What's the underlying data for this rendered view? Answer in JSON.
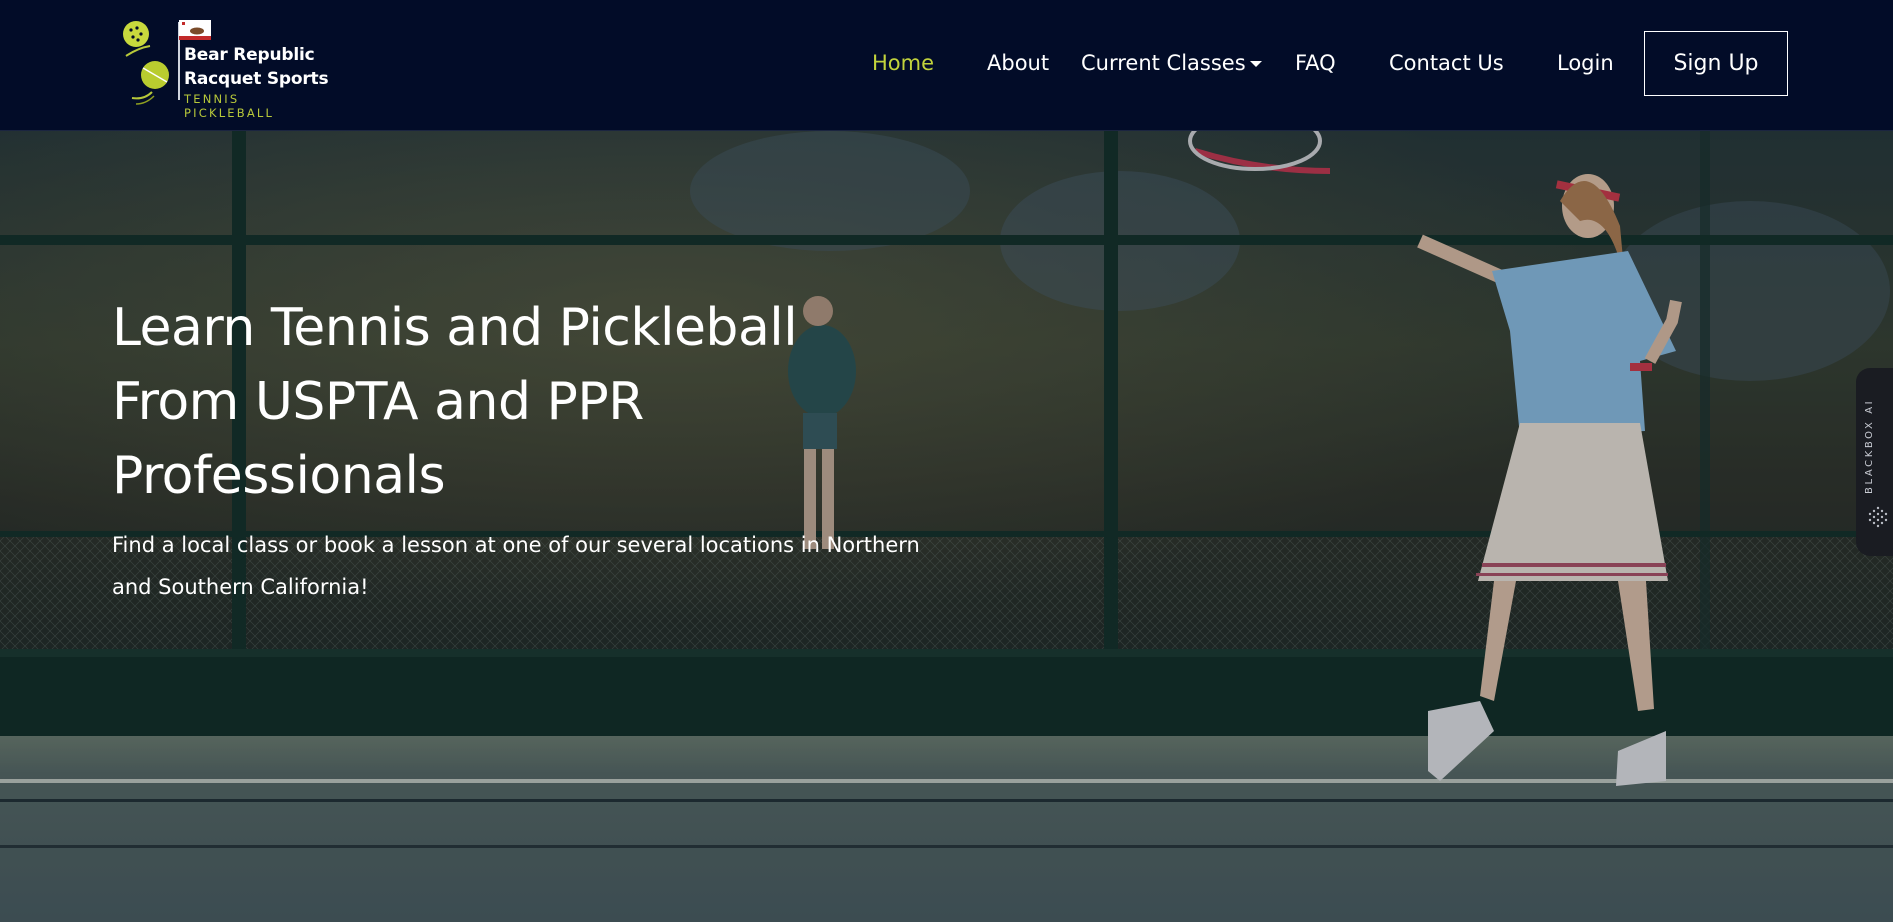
{
  "brand": {
    "line1": "Bear Republic",
    "line2": "Racquet Sports",
    "tagline": "TENNIS PICKLEBALL",
    "accent_color": "#c2d33c",
    "icons": [
      "pickleball-icon",
      "tennis-ball-icon",
      "california-flag-icon"
    ]
  },
  "nav": {
    "items": [
      {
        "label": "Home",
        "active": true
      },
      {
        "label": "About",
        "active": false
      },
      {
        "label": "Current Classes",
        "active": false,
        "has_dropdown": true
      },
      {
        "label": "FAQ",
        "active": false
      },
      {
        "label": "Contact Us",
        "active": false
      },
      {
        "label": "Login",
        "active": false
      }
    ],
    "cta": "Sign Up"
  },
  "hero": {
    "title_line1": "Learn Tennis and Pickleball",
    "title_line2": "From USPTA and PPR",
    "title_line3": "Professionals",
    "subtitle_line1": "Find a local class or book a lesson at one of our several locations in Northern",
    "subtitle_line2": "and Southern California!",
    "background": "tennis-court-photo"
  },
  "side_widget": {
    "label": "BLACKBOX AI"
  },
  "colors": {
    "nav_bg": "#020c28",
    "active_link": "#c2d33c",
    "text": "#ffffff"
  }
}
